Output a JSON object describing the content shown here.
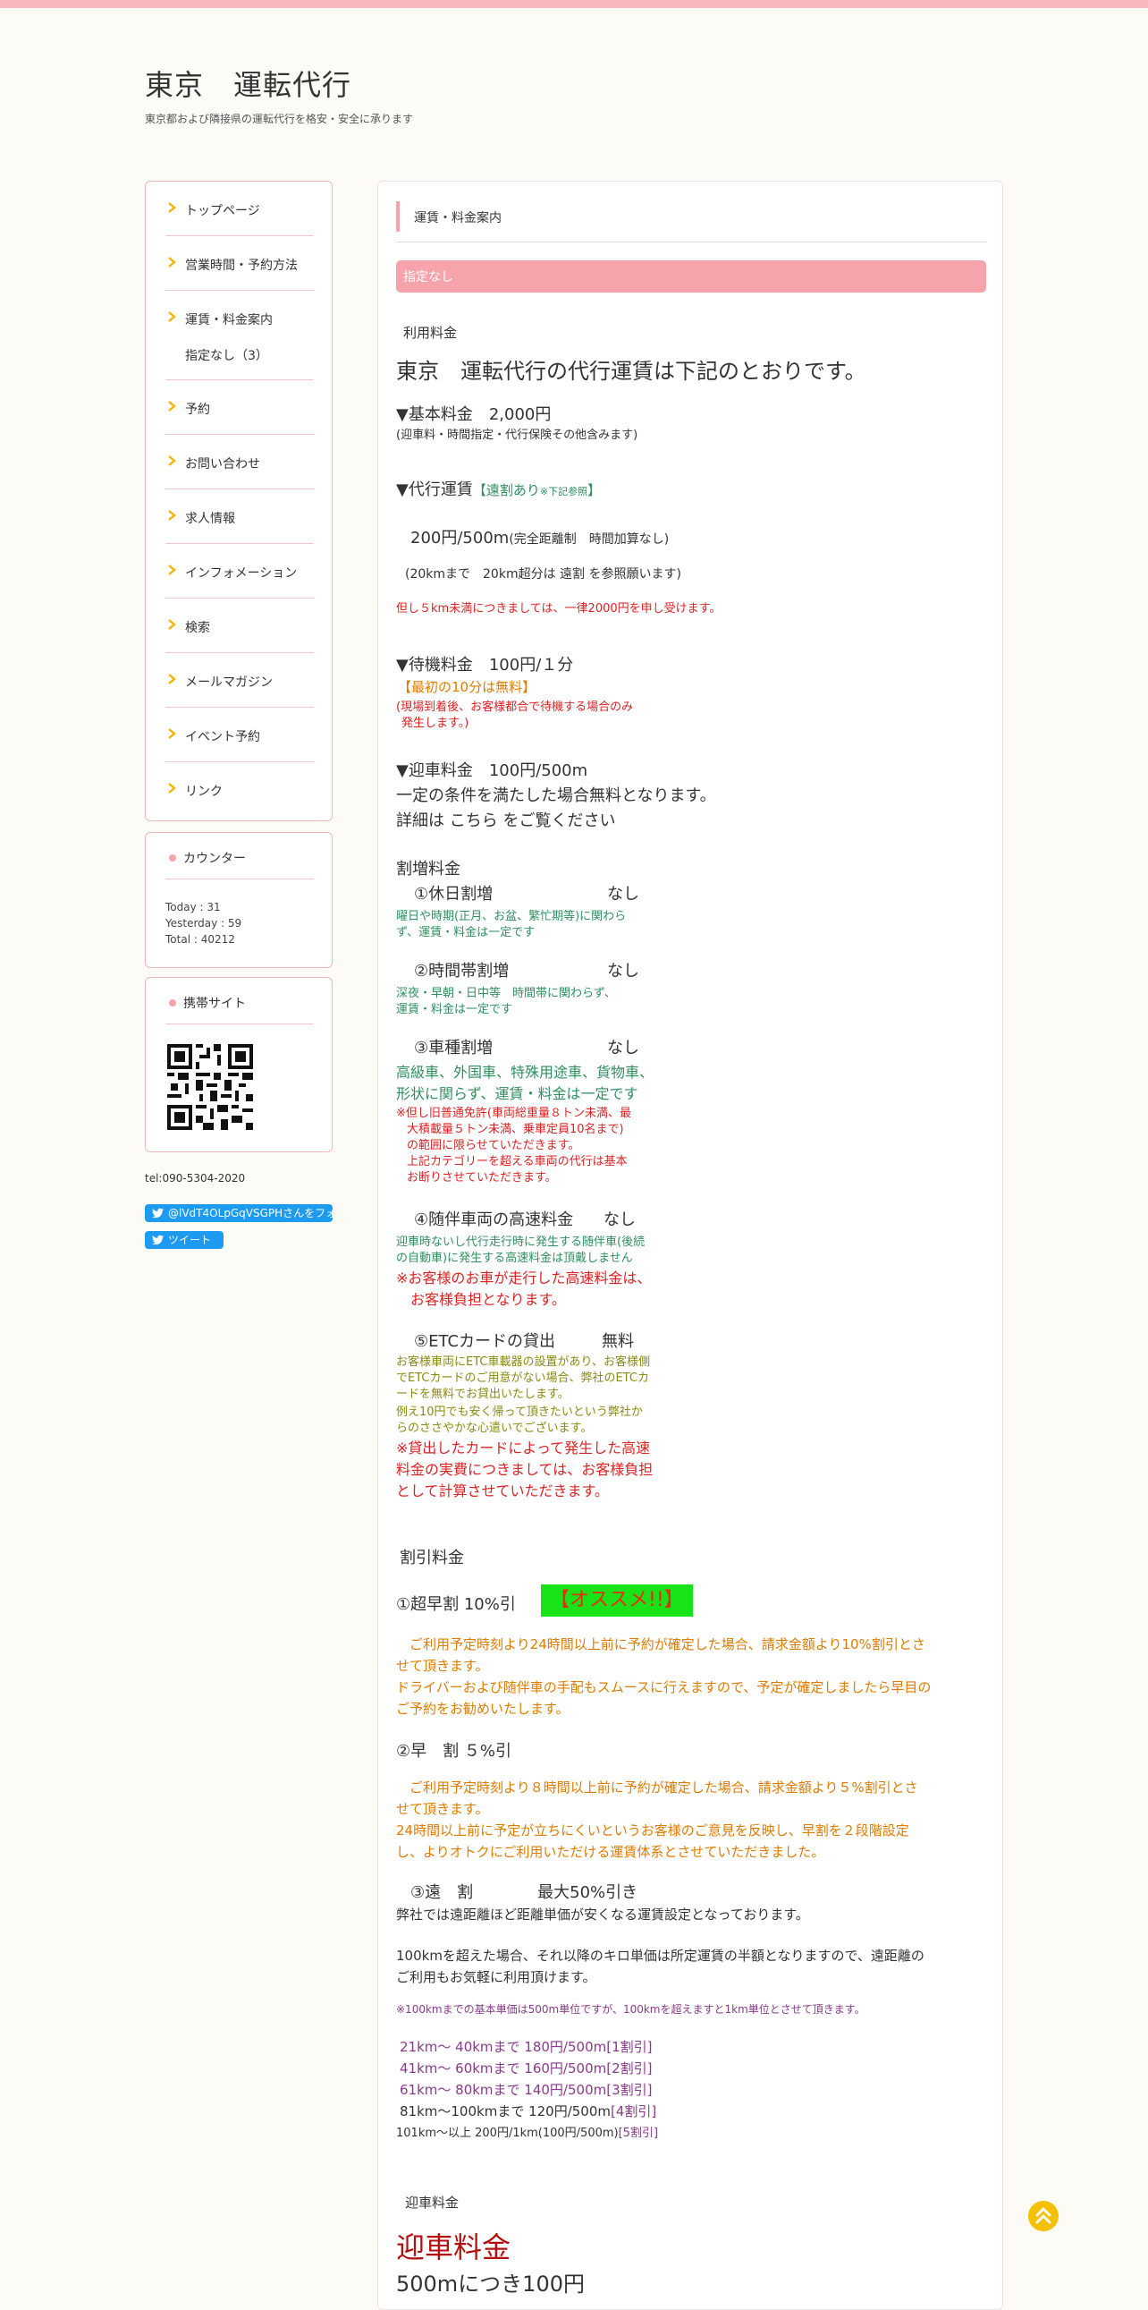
{
  "site": {
    "title": "東京　運転代行",
    "description": "東京都および隣接県の運転代行を格安・安全に承ります"
  },
  "nav": {
    "items": [
      {
        "label": "トップページ"
      },
      {
        "label": "営業時間・予約方法"
      },
      {
        "label": "運賃・料金案内"
      },
      {
        "label": "予約"
      },
      {
        "label": "お問い合わせ"
      },
      {
        "label": "求人情報"
      },
      {
        "label": "インフォメーション"
      },
      {
        "label": "検索"
      },
      {
        "label": "メールマガジン"
      },
      {
        "label": "イベント予約"
      },
      {
        "label": "リンク"
      }
    ],
    "sub_item": "指定なし（3）"
  },
  "counter": {
    "title": "カウンター",
    "today": "Today : 31",
    "yesterday": "Yesterday : 59",
    "total": "Total : 40212"
  },
  "mobile": {
    "title": "携帯サイト"
  },
  "contact": {
    "tel": "tel:090-5304-2020"
  },
  "social": {
    "follow_label": "@lVdT4OLpGqVSGPHさんをフォロー",
    "tweet_label": "ツイート"
  },
  "main": {
    "breadcrumb": "運賃・料金案内",
    "tag": "指定なし",
    "section1_title": "利用料金",
    "heading": "東京　運転代行の代行運賃は下記のとおりです。",
    "basic_fee": "▼基本料金　2,000円",
    "basic_fee_note": "(迎車料・時間指定・代行保険その他含みます)",
    "agency_fee": "▼代行運賃",
    "agency_fee_badge": "【遠割あり",
    "agency_fee_badge_note": "※下記参照",
    "agency_fee_badge_end": "】",
    "per500": "200円/500m",
    "per500_note": "(完全距離制　時間加算なし)",
    "per500_note2": "(20kmまで　20km超分は 遠割 を参照願います)",
    "under5km": "但し５km未満につきましては、一律2000円を申し受けます。",
    "wait_fee": "▼待機料金　100円/１分",
    "wait_free": "【最初の10分は無料】",
    "wait_note1": "(現場到着後、お客様都合で待機する場合のみ",
    "wait_note2": "発生します。)",
    "pickup_fee": "▼迎車料金　100円/500m",
    "pickup_cond": "一定の条件を満たした場合無料となります。",
    "pickup_detail": "詳細は こちら をご覧ください",
    "surcharge_title": "割増料金",
    "s1_title": "①休日割増",
    "s1_val": "なし",
    "s1_note1": "曜日や時期(正月、お盆、繁忙期等)に関わら",
    "s1_note2": "ず、運賃・料金は一定です",
    "s2_title": "②時間帯割増",
    "s2_val": "なし",
    "s2_note1": "深夜・早朝・日中等　時間帯に関わらず、",
    "s2_note2": "運賃・料金は一定です",
    "s3_title": "③車種割増",
    "s3_val": "なし",
    "s3_note1": "高級車、外国車、特殊用途車、貨物車、",
    "s3_note2": "形状に関らず、運賃・料金は一定です",
    "s3_warn1": "※但し旧普通免許(車両総重量８トン未満、最",
    "s3_warn2": "大積載量５トン未満、乗車定員10名まで)",
    "s3_warn3": "の範囲に限らせていただきます。",
    "s3_warn4": "上記カテゴリーを超える車両の代行は基本",
    "s3_warn5": "お断りさせていただきます。",
    "s4_title": "④随伴車両の高速料金",
    "s4_val": "なし",
    "s4_note1": "迎車時ないし代行走行時に発生する随伴車(後続",
    "s4_note2": "の自動車)に発生する高速料金は頂戴しません",
    "s4_warn1": "※お客様のお車が走行した高速料金は、",
    "s4_warn2": "お客様負担となります。",
    "s5_title": "⑤ETCカードの貸出",
    "s5_val": "無料",
    "s5_note1": "お客様車両にETC車載器の設置があり、お客様側",
    "s5_note2": "でETCカードのご用意がない場合、弊社のETCカ",
    "s5_note3": "ードを無料でお貸出いたします。",
    "s5_note4": "例え10円でも安く帰って頂きたいという弊社か",
    "s5_note5": "らのささやかな心遣いでございます。",
    "s5_warn1": "※貸出したカードによって発生した高速",
    "s5_warn2": "料金の実費につきましては、お客様負担",
    "s5_warn3": "として計算させていただきます。",
    "discount_title": "割引料金",
    "d1_title": "①超早割 10%引",
    "d1_badge": "【オススメ!!】",
    "d1_text1": "　ご利用予定時刻より24時間以上前に予約が確定した場合、請求金額より10%割引とさ",
    "d1_text2": "せて頂きます。",
    "d1_text3": "ドライバーおよび随伴車の手配もスムースに行えますので、予定が確定しましたら早目の",
    "d1_text4": "ご予約をお勧めいたします。",
    "d2_title": "②早　割 ５%引",
    "d2_text1": "　ご利用予定時刻より８時間以上前に予約が確定した場合、請求金額より５%割引とさ",
    "d2_text2": "せて頂きます。",
    "d2_text3": "24時間以上前に予定が立ちにくいというお客様のご意見を反映し、早割を２段階設定",
    "d2_text4": "し、よりオトクにご利用いただける運賃体系とさせていただきました。",
    "d3_title": "③遠　割　　　　最大50%引き",
    "d3_text1": "弊社では遠距離ほど距離単価が安くなる運賃設定となっております。",
    "d3_text2": "100kmを超えた場合、それ以降のキロ単価は所定運賃の半額となりますので、遠距離の",
    "d3_text3": "ご利用もお気軽に利用頂けます。",
    "d3_note": "※100kmまでの基本単価は500m単位ですが、100kmを超えますと1km単位とさせて頂きます。",
    "tiers": [
      {
        "label": "21km～ 40kmまで 180円/500m[1割引]"
      },
      {
        "label": "41km～ 60kmまで 160円/500m[2割引]"
      },
      {
        "label": "61km～ 80kmまで 140円/500m[3割引]"
      },
      {
        "range": "81km～100kmまで 120円/500m",
        "disc": "[4割引]"
      },
      {
        "range": "101km～以上 200円/1km(100円/500m)",
        "disc": "[5割引]"
      }
    ],
    "section2_title": "迎車料金",
    "pickup_big": "迎車料金",
    "pickup_rate": "500mにつき100円"
  }
}
